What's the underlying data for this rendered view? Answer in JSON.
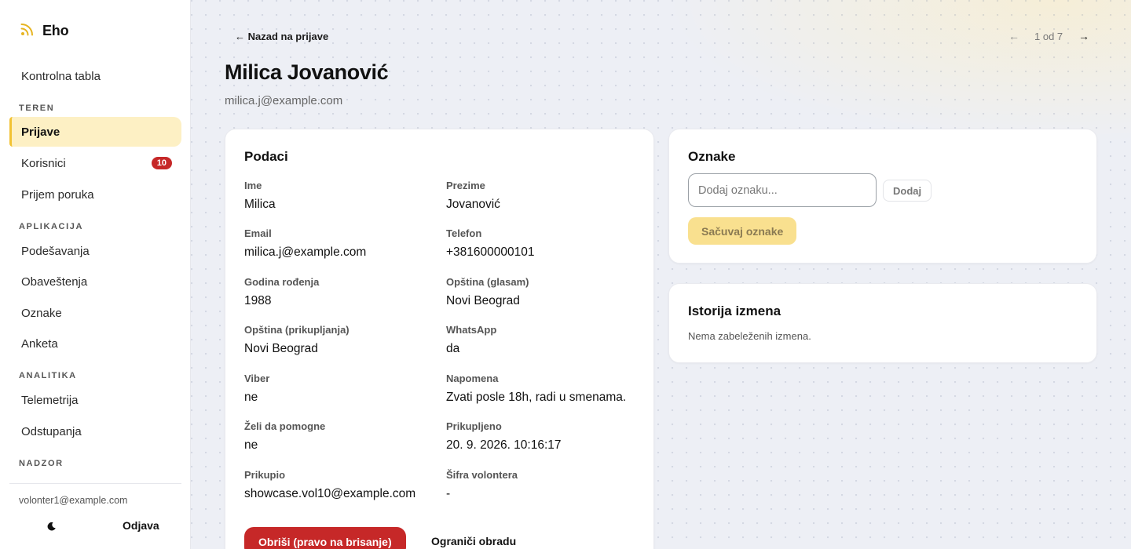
{
  "app": {
    "name": "Eho",
    "logo_icon": "rss-icon",
    "accent": "#f2c233"
  },
  "sidebar": {
    "dashboard": "Kontrolna tabla",
    "sections": [
      {
        "title": "TEREN",
        "items": [
          {
            "label": "Prijave",
            "active": true
          },
          {
            "label": "Korisnici",
            "badge": "10"
          },
          {
            "label": "Prijem poruka"
          }
        ]
      },
      {
        "title": "APLIKACIJA",
        "items": [
          {
            "label": "Podešavanja"
          },
          {
            "label": "Obaveštenja"
          },
          {
            "label": "Oznake"
          },
          {
            "label": "Anketa"
          }
        ]
      },
      {
        "title": "ANALITIKA",
        "items": [
          {
            "label": "Telemetrija"
          },
          {
            "label": "Odstupanja"
          }
        ]
      },
      {
        "title": "NADZOR",
        "items": []
      }
    ],
    "user_email": "volonter1@example.com",
    "theme_icon": "moon-icon",
    "logout": "Odjava"
  },
  "header": {
    "back": "← Nazad na prijave",
    "pager": {
      "prev": "←",
      "text": "1 od 7",
      "next": "→"
    },
    "title": "Milica Jovanović",
    "subtitle": "milica.j@example.com"
  },
  "details": {
    "title": "Podaci",
    "fields": [
      {
        "label": "Ime",
        "value": "Milica"
      },
      {
        "label": "Prezime",
        "value": "Jovanović"
      },
      {
        "label": "Email",
        "value": "milica.j@example.com"
      },
      {
        "label": "Telefon",
        "value": "+381600000101"
      },
      {
        "label": "Godina rođenja",
        "value": "1988"
      },
      {
        "label": "Opština (glasam)",
        "value": "Novi Beograd"
      },
      {
        "label": "Opština (prikupljanja)",
        "value": "Novi Beograd"
      },
      {
        "label": "WhatsApp",
        "value": "da"
      },
      {
        "label": "Viber",
        "value": "ne"
      },
      {
        "label": "Napomena",
        "value": "Zvati posle 18h, radi u smenama."
      },
      {
        "label": "Želi da pomogne",
        "value": "ne"
      },
      {
        "label": "Prikupljeno",
        "value": "20. 9. 2026. 10:16:17"
      },
      {
        "label": "Prikupio",
        "value": "showcase.vol10@example.com"
      },
      {
        "label": "Šifra volontera",
        "value": "-"
      }
    ],
    "delete_button": "Obriši (pravo na brisanje)",
    "restrict_button": "Ograniči obradu",
    "delete_color": "#c62828"
  },
  "tags": {
    "title": "Oznake",
    "input_placeholder": "Dodaj oznaku...",
    "add_button": "Dodaj",
    "save_button": "Sačuvaj oznake"
  },
  "history": {
    "title": "Istorija izmena",
    "empty": "Nema zabeleženih izmena."
  }
}
